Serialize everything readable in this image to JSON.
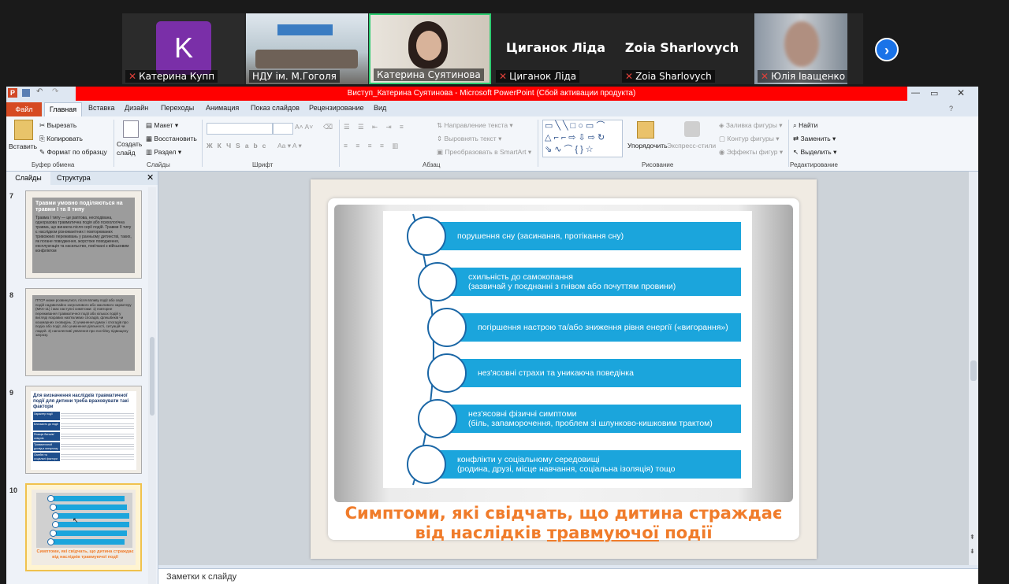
{
  "participants": [
    {
      "avatar_letter": "K",
      "name": "Катерина Купп",
      "muted": true
    },
    {
      "name": "НДУ ім. М.Гоголя",
      "muted": false
    },
    {
      "name": "Катерина Суятинова",
      "muted": false,
      "active": true
    },
    {
      "display_name": "Циганок Ліда",
      "name": "Циганок Ліда",
      "muted": true
    },
    {
      "display_name": "Zoia Sharlovych",
      "name": "Zoia Sharlovych",
      "muted": true
    },
    {
      "name": "Юлія Іващенко",
      "muted": true
    }
  ],
  "next_icon": "chevron-right-icon",
  "window": {
    "title": "Виступ_Катерина Суятинова - Microsoft PowerPoint (Сбой активации продукта)"
  },
  "ribbon_tabs": [
    "Файл",
    "Главная",
    "Вставка",
    "Дизайн",
    "Переходы",
    "Анимация",
    "Показ слайдов",
    "Рецензирование",
    "Вид"
  ],
  "ribbon": {
    "paste": "Вставить",
    "cut": "Вырезать",
    "copy": "Копировать",
    "format_painter": "Формат по образцу",
    "clipboard_group": "Буфер обмена",
    "new_slide": "Создать слайд",
    "layout": "Макет",
    "reset": "Восстановить",
    "section": "Раздел",
    "slides_group": "Слайды",
    "font_group": "Шрифт",
    "text_direction": "Направление текста",
    "align_text": "Выровнять текст",
    "smartart": "Преобразовать в SmartArt",
    "paragraph_group": "Абзац",
    "arrange": "Упорядочить",
    "quick_styles": "Экспресс-стили",
    "shape_fill": "Заливка фигуры",
    "shape_outline": "Контур фигуры",
    "shape_effects": "Эффекты фигур",
    "drawing_group": "Рисование",
    "find": "Найти",
    "replace": "Заменить",
    "select": "Выделить",
    "editing_group": "Редактирование"
  },
  "panel": {
    "tab_slides": "Слайды",
    "tab_outline": "Структура",
    "thumbs": [
      {
        "num": "7",
        "title": "Травми умовно поділяються на травми І та ІІ типу",
        "body": "Травма І типу — це раптова, несподівана, одноразова травматична подія або психологічна травма, що виникла після серії подій. Травми ІІ типу є наслідком різноманітних і повторюваних тривожних переживань у ранньому дитинстві, таких, як погане поводження, жорстоке поводження, експлуатація та насильство, пов'язані з військовим конфліктом"
      },
      {
        "num": "8",
        "title": "",
        "body": "ПТСР може розвинутися, після впливу події або серії подій надзвичайно загрозливого або жахливого характеру (МКХ-11) і має наступні симптоми: 1) повторне переживання травматичної події або кількох подій у вигляді яскравих нав'язливих спогадів, флешбеків чи кошмарних сновидінь. 2) уникнення думок і спогадів про подію або події, або уникнення діяльності, ситуацій чи людей. 3) наполегливі уявлення про постійну підвищену загрозу."
      },
      {
        "num": "9",
        "title": "Для визначення наслідків травматичної події для дитини треба враховувати такі фактори",
        "rows": [
          "Характер події",
          "Близькість до події",
          "Реакція батьків/опікунів",
          "Травматичний досвід в минулому",
          "Сімейні та соціальні фактори"
        ]
      },
      {
        "num": "10",
        "caption": "Симптоми, які свідчать, що дитина страждає від наслідків травмуючої події"
      }
    ]
  },
  "slide": {
    "items": [
      {
        "line1": "порушення сну (засинання, протікання сну)",
        "line2": ""
      },
      {
        "line1": "схильність до самокопання",
        "line2": "(зазвичай у поєднанні з гнівом або почуттям провини)"
      },
      {
        "line1": "погіршення настрою та/або зниження рівня енергії («вигорання»)",
        "line2": ""
      },
      {
        "line1": "нез'ясовні страхи та уникаюча поведінка",
        "line2": ""
      },
      {
        "line1": "нез'ясовні фізичні симптоми",
        "line2": "(біль, запаморочення, проблем зі шлунково-кишковим трактом)"
      },
      {
        "line1": "конфлікти у соціальному середовищі",
        "line2": "(родина, друзі, місце навчання, соціальна ізоляція) тощо"
      }
    ],
    "caption_line1": "Симптоми, які свідчать, що дитина страждає",
    "caption_line2_a": "від наслідків ",
    "caption_line2_b": "травмуючої",
    "caption_line2_c": " події"
  },
  "notes_placeholder": "Заметки к слайду",
  "colors": {
    "bar": "#1ba5dc",
    "circle_border": "#1b67a6",
    "caption": "#f07c2b",
    "file_tab": "#d64a22",
    "activation_bar": "#ff0000"
  }
}
